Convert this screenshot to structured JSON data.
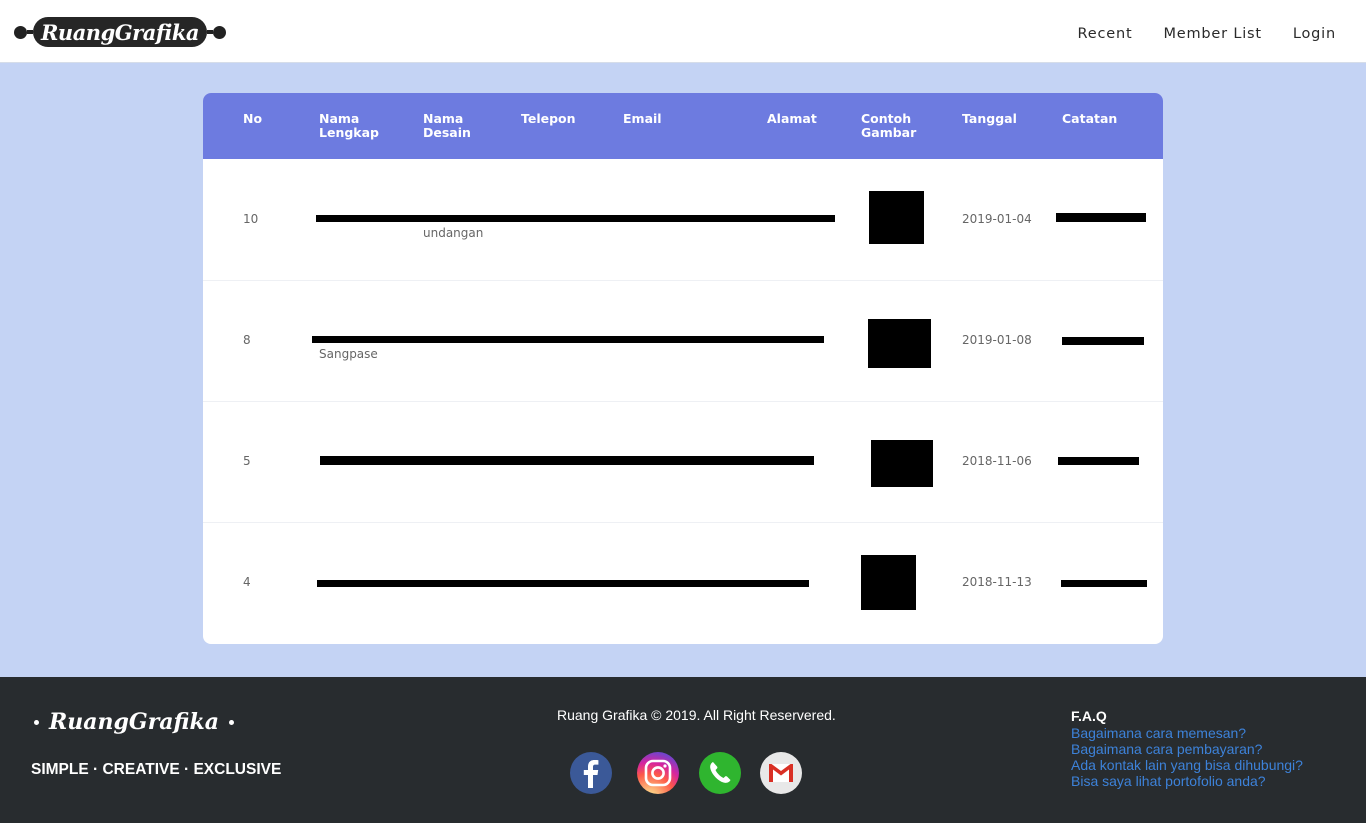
{
  "brand": {
    "name": "RuangGrafika"
  },
  "nav": {
    "items": [
      "Recent",
      "Member List",
      "Login"
    ]
  },
  "table": {
    "headers": [
      {
        "line1": "No",
        "line2": ""
      },
      {
        "line1": "Nama",
        "line2": "Lengkap"
      },
      {
        "line1": "Nama",
        "line2": "Desain"
      },
      {
        "line1": "Telepon",
        "line2": ""
      },
      {
        "line1": "Email",
        "line2": ""
      },
      {
        "line1": "Alamat",
        "line2": ""
      },
      {
        "line1": "Contoh",
        "line2": "Gambar"
      },
      {
        "line1": "Tanggal",
        "line2": ""
      },
      {
        "line1": "Catatan",
        "line2": ""
      }
    ],
    "rows": [
      {
        "no": "10",
        "visible_text": "undangan",
        "tanggal": "2019-01-04"
      },
      {
        "no": "8",
        "visible_text": "Sangpase",
        "tanggal": "2019-01-08"
      },
      {
        "no": "5",
        "visible_text": "",
        "tanggal": "2018-11-06"
      },
      {
        "no": "4",
        "visible_text": "",
        "tanggal": "2018-11-13"
      }
    ]
  },
  "footer": {
    "brand": "RuangGrafika",
    "tagline": "SIMPLE · CREATIVE · EXCLUSIVE",
    "copyright": "Ruang Grafika © 2019. All Right Reservered.",
    "social": [
      {
        "icon": "facebook-icon",
        "color": "#3b5998"
      },
      {
        "icon": "instagram-icon",
        "color": "#d6249f"
      },
      {
        "icon": "whatsapp-icon",
        "color": "#2fb52f"
      },
      {
        "icon": "gmail-icon",
        "color": "#e8e8e8"
      }
    ],
    "faq": {
      "title": "F.A.Q",
      "links": [
        "Bagaimana cara memesan?",
        "Bagaimana cara pembayaran?",
        "Ada kontak lain yang bisa dihubungi?",
        "Bisa saya lihat portofolio anda?"
      ]
    }
  },
  "colors": {
    "accent": "#6d7be0",
    "page_bg": "#c4d3f4",
    "footer_bg": "#282c2f",
    "link": "#3d82d9"
  }
}
